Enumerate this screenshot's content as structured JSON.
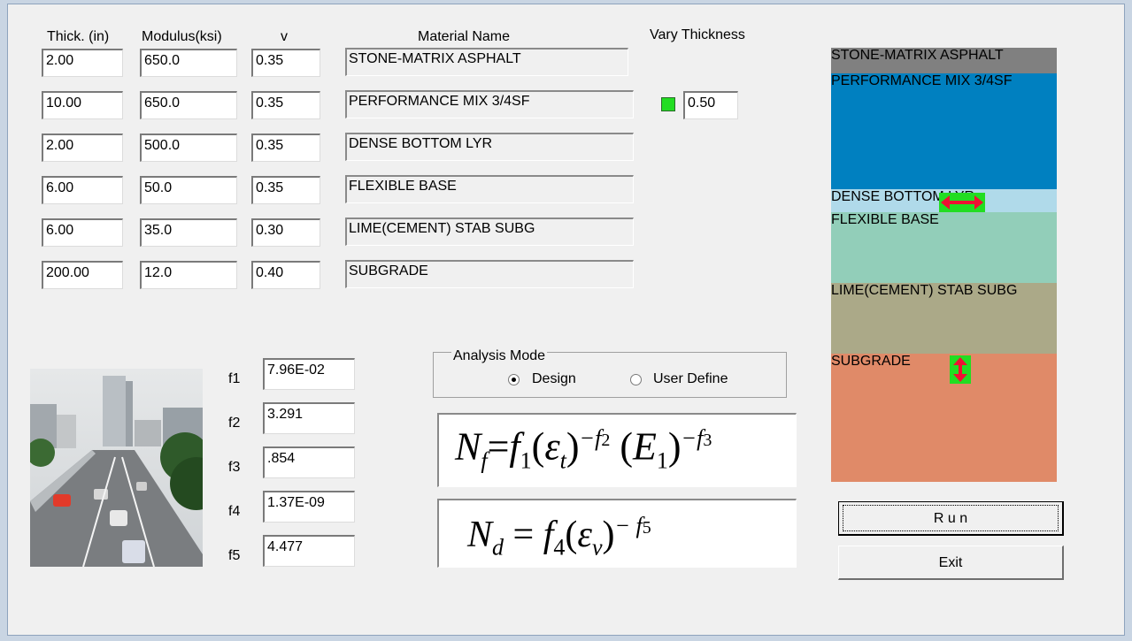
{
  "headers": {
    "thickness": "Thick. (in)",
    "modulus": "Modulus(ksi)",
    "poisson": "v",
    "material": "Material Name",
    "vary": "Vary Thickness"
  },
  "layers": [
    {
      "thickness": "2.00",
      "modulus": "650.0",
      "poisson": "0.35",
      "material": "STONE-MATRIX ASPHALT"
    },
    {
      "thickness": "10.00",
      "modulus": "650.0",
      "poisson": "0.35",
      "material": "PERFORMANCE MIX 3/4SF"
    },
    {
      "thickness": "2.00",
      "modulus": "500.0",
      "poisson": "0.35",
      "material": "DENSE BOTTOM LYR"
    },
    {
      "thickness": "6.00",
      "modulus": "50.0",
      "poisson": "0.35",
      "material": "FLEXIBLE BASE"
    },
    {
      "thickness": "6.00",
      "modulus": "35.0",
      "poisson": "0.30",
      "material": "LIME(CEMENT) STAB SUBG"
    },
    {
      "thickness": "200.00",
      "modulus": "12.0",
      "poisson": "0.40",
      "material": "SUBGRADE"
    }
  ],
  "vary_thickness": {
    "value": "0.50",
    "indicator_color": "#22dd22"
  },
  "coefficients": [
    {
      "label": "f1",
      "value": "7.96E-02"
    },
    {
      "label": "f2",
      "value": "3.291"
    },
    {
      "label": "f3",
      "value": ".854"
    },
    {
      "label": "f4",
      "value": "1.37E-09"
    },
    {
      "label": "f5",
      "value": "4.477"
    }
  ],
  "analysis_mode": {
    "title": "Analysis Mode",
    "options": [
      "Design",
      "User Define"
    ],
    "selected": "Design"
  },
  "equations": {
    "fatigue": {
      "N": "N",
      "N_sub": "f",
      "f1": "f",
      "f1_sub": "1",
      "eps": "ε",
      "eps_sub": "t",
      "exp1": "−f",
      "exp1_sub": "2",
      "E": "E",
      "E_sub": "1",
      "exp2": "−f",
      "exp2_sub": "3",
      "eq": "="
    },
    "rutting": {
      "N": "N",
      "N_sub": "d",
      "eq": "=",
      "f4": "f",
      "f4_sub": "4",
      "eps": "ε",
      "eps_sub": "v",
      "exp": "− f",
      "exp_sub": "5"
    }
  },
  "profile": {
    "layers": [
      {
        "label": "STONE-MATRIX ASPHALT",
        "color": "#808080"
      },
      {
        "label": "PERFORMANCE MIX 3/4SF",
        "color": "#0080c0"
      },
      {
        "label": "DENSE BOTTOM LYR",
        "color": "#b0daea"
      },
      {
        "label": "FLEXIBLE BASE",
        "color": "#92ceb9"
      },
      {
        "label": "LIME(CEMENT) STAB SUBG",
        "color": "#aba988"
      },
      {
        "label": "SUBGRADE",
        "color": "#e08a68"
      }
    ],
    "arrow_color": "#ee1133",
    "handle_color": "#22dd22"
  },
  "buttons": {
    "run": "R u n",
    "exit": "Exit"
  }
}
